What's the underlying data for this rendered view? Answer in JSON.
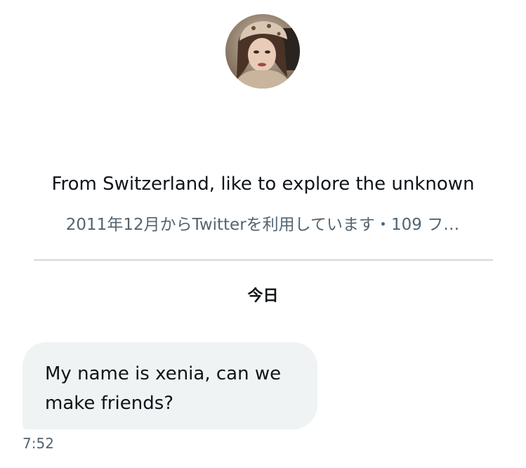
{
  "profile": {
    "avatar_icon": "profile-photo",
    "bio": "From Switzerland, like to explore the unknown",
    "meta": "2011年12月からTwitterを利用しています・109 フ…"
  },
  "conversation": {
    "day_label": "今日",
    "messages": [
      {
        "text_line1": "My name is xenia, can we",
        "text_line2": "make friends?",
        "time": "7:52"
      }
    ]
  },
  "colors": {
    "text_primary": "#0f1419",
    "text_secondary": "#536471",
    "bubble_bg": "#eff3f4",
    "divider": "#cfd9de"
  }
}
